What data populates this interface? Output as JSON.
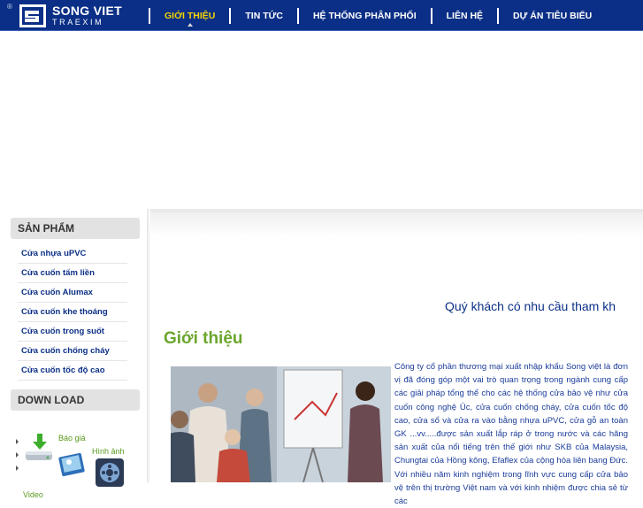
{
  "header": {
    "logo": {
      "registered": "®",
      "line1": "SONG VIET",
      "line2": "TRAEXIM"
    },
    "nav": [
      {
        "label": "GIỚI THIỆU",
        "active": true
      },
      {
        "label": "TIN TỨC",
        "active": false
      },
      {
        "label": "HỆ THỐNG PHÂN PHỐI",
        "active": false
      },
      {
        "label": "LIÊN HỆ",
        "active": false
      },
      {
        "label": "DỰ ÁN TIÊU BIỂU",
        "active": false
      }
    ]
  },
  "sidebar": {
    "products_title": "SẢN PHẨM",
    "products": [
      "Cửa nhựa uPVC",
      "Cửa cuốn tấm liền",
      "Cửa cuốn Alumax",
      "Cửa cuốn khe thoáng",
      "Cửa cuốn trong suốt",
      "Cửa cuốn chống cháy",
      "Cửa cuốn tốc độ cao"
    ],
    "download_title": "DOWN LOAD",
    "downloads": [
      {
        "label": "Báo giá",
        "icon": "download-drive-icon"
      },
      {
        "label": "Hình ảnh",
        "icon": "image-gallery-icon"
      },
      {
        "label": "Video",
        "icon": "video-film-icon"
      }
    ]
  },
  "main": {
    "marquee": "Quý khách có nhu cầu tham kh",
    "intro_title": "Giới thiệu",
    "intro_text": "Công ty cổ phần thương mại xuất nhập khẩu Song việt là đơn vị đã đóng góp một vai trò quan trọng trong ngành cung cấp các giải pháp tổng thể cho các hệ thống cửa bảo vệ như cửa cuốn công nghệ Úc, cửa cuốn chống cháy, cửa cuốn tốc độ cao, cửa sổ và cửa ra vào bằng nhựa uPVC, cửa gỗ an toàn GK ...vv.....được sản xuất lắp ráp ở trong nước và các hãng sản xuất của nổi tiếng trên thế giới như SKB của Malaysia, Chungtai của Hồng kông, Efaflex của cộng hòa liên bang Đức. Với nhiều năm kinh nghiệm trong lĩnh vực cung cấp cửa bảo vệ trên thị trường Việt nam và với kinh nhiệm được chia sẻ từ các"
  },
  "colors": {
    "brand_blue": "#0b2f86",
    "nav_active": "#f5d400",
    "accent_green": "#6ba52d",
    "text_blue": "#1a3c9a"
  }
}
